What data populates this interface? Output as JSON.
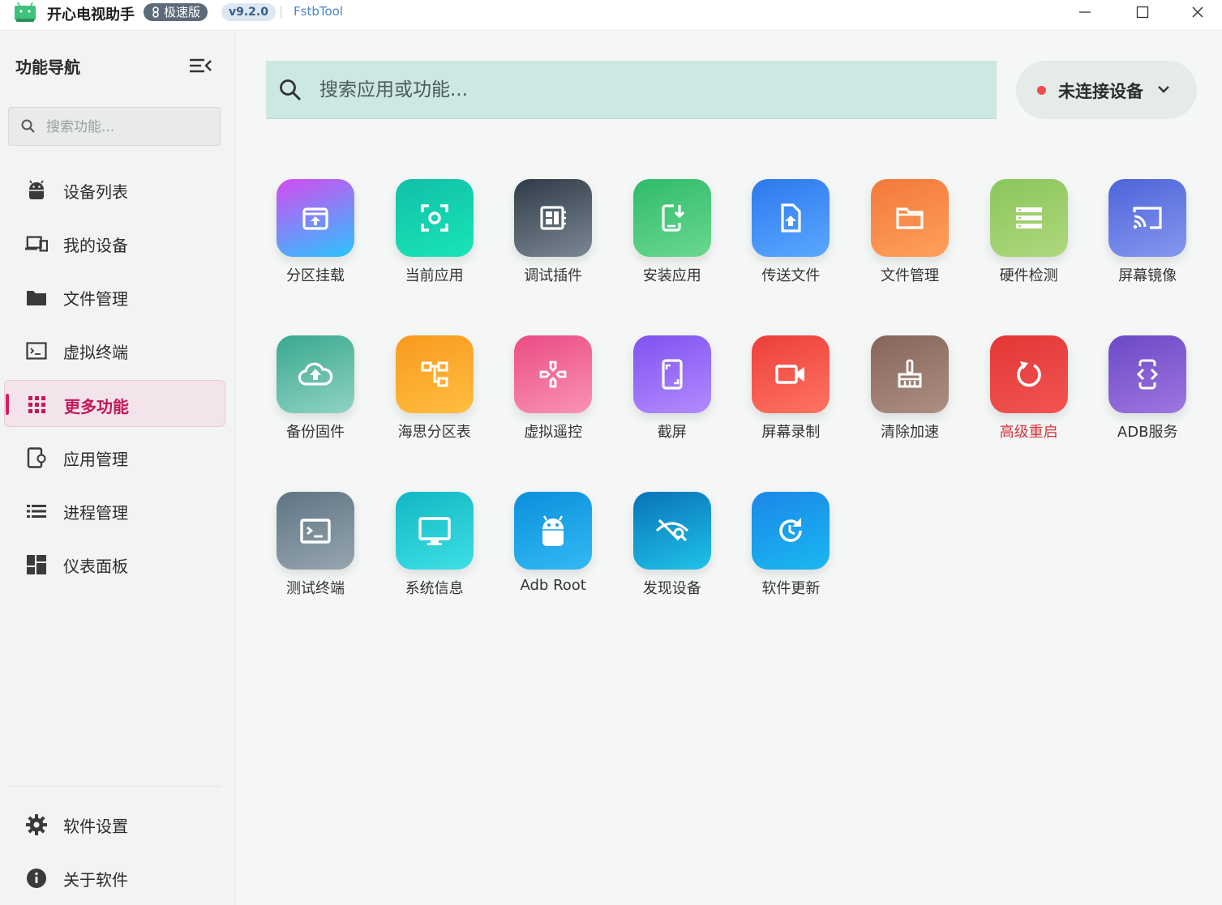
{
  "titlebar": {
    "app_title": "开心电视助手",
    "edition": "极速版",
    "version": "v9.2.0",
    "brand": "FstbTool",
    "minimize_icon": "minimize-icon",
    "maximize_icon": "maximize-icon",
    "close_icon": "close-icon"
  },
  "sidebar": {
    "title": "功能导航",
    "search_placeholder": "搜索功能...",
    "items": [
      {
        "label": "设备列表",
        "icon": "android-icon"
      },
      {
        "label": "我的设备",
        "icon": "devices-icon"
      },
      {
        "label": "文件管理",
        "icon": "folder-icon"
      },
      {
        "label": "虚拟终端",
        "icon": "terminal-icon"
      },
      {
        "label": "更多功能",
        "icon": "apps-grid-icon",
        "active": true
      },
      {
        "label": "应用管理",
        "icon": "app-settings-icon"
      },
      {
        "label": "进程管理",
        "icon": "list-icon"
      },
      {
        "label": "仪表面板",
        "icon": "dashboard-icon"
      }
    ],
    "bottom_items": [
      {
        "label": "软件设置",
        "icon": "gear-icon"
      },
      {
        "label": "关于软件",
        "icon": "info-icon"
      }
    ]
  },
  "main": {
    "search_placeholder": "搜索应用或功能...",
    "device_status": "未连接设备",
    "status_color": "#ef4d4d",
    "tiles": [
      {
        "label": "分区挂载",
        "icon": "partition-mount-icon"
      },
      {
        "label": "当前应用",
        "icon": "focus-app-icon"
      },
      {
        "label": "调试插件",
        "icon": "debug-plugin-icon"
      },
      {
        "label": "安装应用",
        "icon": "install-app-icon"
      },
      {
        "label": "传送文件",
        "icon": "file-upload-icon"
      },
      {
        "label": "文件管理",
        "icon": "folder-icon"
      },
      {
        "label": "硬件检测",
        "icon": "hardware-list-icon"
      },
      {
        "label": "屏幕镜像",
        "icon": "cast-icon"
      },
      {
        "label": "备份固件",
        "icon": "cloud-upload-icon"
      },
      {
        "label": "海思分区表",
        "icon": "partition-tree-icon"
      },
      {
        "label": "虚拟遥控",
        "icon": "gamepad-icon"
      },
      {
        "label": "截屏",
        "icon": "screenshot-icon"
      },
      {
        "label": "屏幕录制",
        "icon": "video-camera-icon"
      },
      {
        "label": "清除加速",
        "icon": "broom-icon"
      },
      {
        "label": "高级重启",
        "icon": "restart-icon",
        "danger": true
      },
      {
        "label": "ADB服务",
        "icon": "adb-service-icon"
      },
      {
        "label": "测试终端",
        "icon": "terminal-icon"
      },
      {
        "label": "系统信息",
        "icon": "monitor-icon"
      },
      {
        "label": "Adb Root",
        "icon": "android-icon"
      },
      {
        "label": "发现设备",
        "icon": "discover-icon"
      },
      {
        "label": "软件更新",
        "icon": "update-icon"
      }
    ]
  },
  "colors": {
    "accent": "#d81b60",
    "search_bg": "#cde8e3",
    "danger": "#d8333a"
  }
}
